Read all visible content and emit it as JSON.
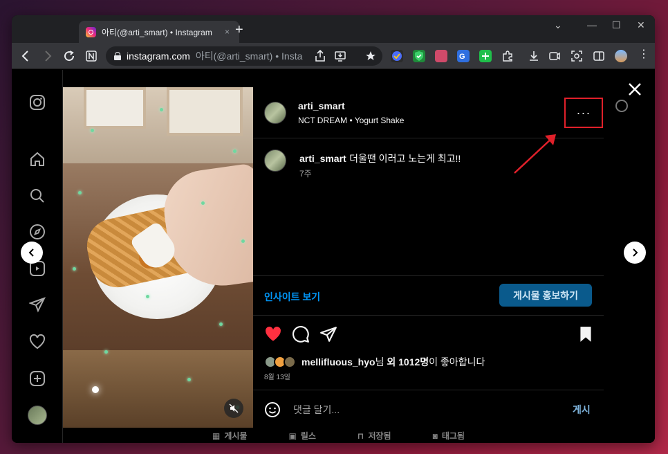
{
  "browser": {
    "tab_title": "아티(@arti_smart) • Instagram",
    "tab_close": "×",
    "new_tab": "+",
    "url_domain": "instagram.com",
    "url_path": "아티(@arti_smart) • Insta",
    "window_controls": [
      "⌄",
      "—",
      "☐",
      "✕"
    ]
  },
  "post": {
    "author": {
      "username": "arti_smart",
      "audio": "NCT DREAM • Yogurt Shake"
    },
    "more_label": "···",
    "caption": {
      "username": "arti_smart",
      "text": "더울땐 이러고 노는게 최고!!",
      "time": "7주"
    },
    "insight_label": "인사이트 보기",
    "promote_label": "게시물 홍보하기",
    "liked": true,
    "saved": true,
    "likes": {
      "first_user": "mellifluous_hyo",
      "suffix_1": "님 ",
      "count_text": "외 1012명",
      "suffix_2": "이 좋아합니다"
    },
    "date": "8월 13일",
    "comment_placeholder": "댓글 달기...",
    "post_button": "게시"
  },
  "profile_tabs": [
    "게시물",
    "릴스",
    "저장됨",
    "태그됨"
  ],
  "colors": {
    "accent": "#0095f6",
    "like": "#ff3040",
    "annotation": "#e0202a"
  }
}
